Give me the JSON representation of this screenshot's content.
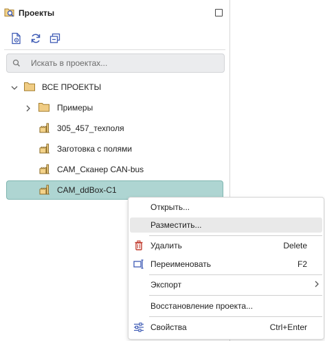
{
  "panel": {
    "title": "Проекты",
    "toolbar": {
      "items": [
        {
          "icon": "new-project-icon"
        },
        {
          "icon": "refresh-icon"
        },
        {
          "icon": "collapse-all-icon"
        }
      ]
    },
    "search": {
      "placeholder": "Искать в проектах..."
    }
  },
  "tree": {
    "root": {
      "label": "ВСЕ ПРОЕКТЫ",
      "expanded": true
    },
    "items": [
      {
        "label": "Примеры",
        "type": "folder",
        "expanded": false
      },
      {
        "label": "305_457_техполя",
        "type": "project"
      },
      {
        "label": "Заготовка с полями",
        "type": "project"
      },
      {
        "label": "CAM_Сканер CAN-bus",
        "type": "project"
      },
      {
        "label": "CAM_ddBox-C1",
        "type": "project",
        "selected": true
      }
    ]
  },
  "context_menu": {
    "open": "Открыть...",
    "place": "Разместить...",
    "delete": "Удалить",
    "delete_key": "Delete",
    "rename": "Переименовать",
    "rename_key": "F2",
    "export": "Экспорт",
    "restore": "Восстановление проекта...",
    "properties": "Свойства",
    "properties_key": "Ctrl+Enter"
  },
  "colors": {
    "selection": "#aed5d2",
    "folder": "#e8c27a",
    "delete_icon": "#c0392b",
    "accent_icon": "#3e5bb5"
  }
}
